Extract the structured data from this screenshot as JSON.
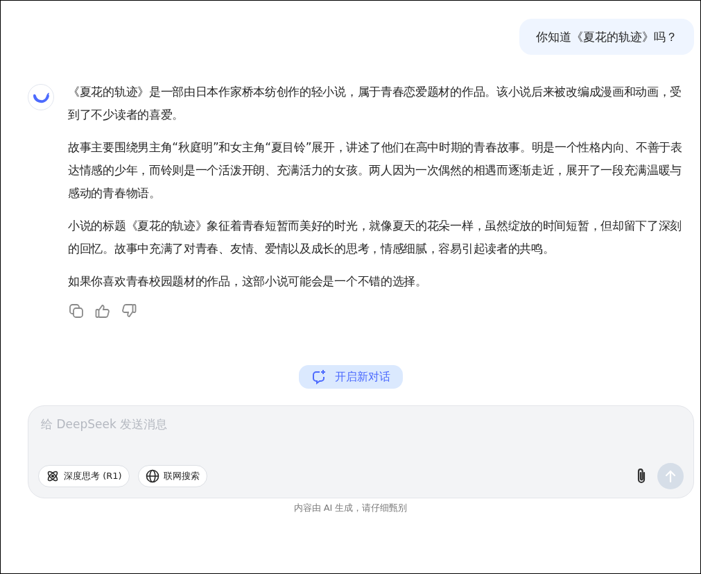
{
  "user_message": "你知道《夏花的轨迹》吗？",
  "assistant_message": {
    "paragraphs": [
      "《夏花的轨迹》是一部由日本作家桥本纺创作的轻小说，属于青春恋爱题材的作品。该小说后来被改编成漫画和动画，受到了不少读者的喜爱。",
      "故事主要围绕男主角“秋庭明”和女主角“夏目铃”展开，讲述了他们在高中时期的青春故事。明是一个性格内向、不善于表达情感的少年，而铃则是一个活泼开朗、充满活力的女孩。两人因为一次偶然的相遇而逐渐走近，展开了一段充满温暖与感动的青春物语。",
      "小说的标题《夏花的轨迹》象征着青春短暂而美好的时光，就像夏天的花朵一样，虽然绽放的时间短暂，但却留下了深刻的回忆。故事中充满了对青春、友情、爱情以及成长的思考，情感细腻，容易引起读者的共鸣。",
      "如果你喜欢青春校园题材的作品，这部小说可能会是一个不错的选择。"
    ]
  },
  "new_chat_button": "开启新对话",
  "composer": {
    "placeholder": "给 DeepSeek 发送消息",
    "toggles": [
      {
        "kind": "think",
        "label": "深度思考 (R1)",
        "selected": false
      },
      {
        "kind": "search",
        "label": "联网搜索",
        "selected": false
      }
    ],
    "send_disabled": true
  },
  "disclaimer": "内容由 AI 生成，请仔细甄别"
}
